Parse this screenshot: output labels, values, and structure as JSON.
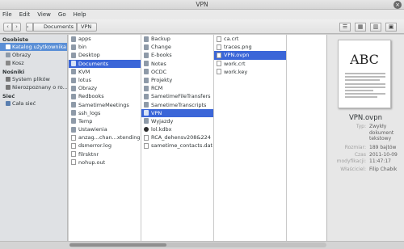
{
  "window": {
    "title": "VPN"
  },
  "menu": [
    "File",
    "Edit",
    "View",
    "Go",
    "Help"
  ],
  "toolbar": {
    "back": "‹",
    "forward": "›",
    "breadcrumb": [
      "Documents",
      "VPN"
    ],
    "views": [
      "☰",
      "▦",
      "▥",
      "▣"
    ]
  },
  "sidebar": {
    "sections": [
      {
        "title": "Osobiste",
        "items": [
          {
            "label": "Katalog użytkownika",
            "icon": "home-icon",
            "selected": true
          },
          {
            "label": "Obrazy",
            "icon": "folder-icon",
            "selected": false
          },
          {
            "label": "Kosz",
            "icon": "trash-icon",
            "selected": false
          }
        ]
      },
      {
        "title": "Nośniki",
        "items": [
          {
            "label": "System plików",
            "icon": "drive-icon",
            "selected": false
          },
          {
            "label": "Nierozpoznany o ro...",
            "icon": "drive-icon",
            "selected": false
          }
        ]
      },
      {
        "title": "Sieć",
        "items": [
          {
            "label": "Cała sieć",
            "icon": "network-icon",
            "selected": false
          }
        ]
      }
    ]
  },
  "columns": [
    {
      "items": [
        {
          "name": "apps",
          "type": "folder"
        },
        {
          "name": "bin",
          "type": "folder"
        },
        {
          "name": "Desktop",
          "type": "folder"
        },
        {
          "name": "Documents",
          "type": "folder",
          "selected": true
        },
        {
          "name": "KVM",
          "type": "folder"
        },
        {
          "name": "lotus",
          "type": "folder"
        },
        {
          "name": "Obrazy",
          "type": "folder"
        },
        {
          "name": "Redbooks",
          "type": "folder"
        },
        {
          "name": "SametimeMeetings",
          "type": "folder"
        },
        {
          "name": "ssh_logs",
          "type": "folder"
        },
        {
          "name": "Temp",
          "type": "folder"
        },
        {
          "name": "Ustawienia",
          "type": "folder"
        },
        {
          "name": "anzag...chan...xtending...fs",
          "type": "file"
        },
        {
          "name": "dsmerror.log",
          "type": "file"
        },
        {
          "name": "filrsktnr",
          "type": "file"
        },
        {
          "name": "nohup.out",
          "type": "file"
        }
      ]
    },
    {
      "items": [
        {
          "name": "Backup",
          "type": "folder"
        },
        {
          "name": "Change",
          "type": "folder"
        },
        {
          "name": "E-books",
          "type": "folder"
        },
        {
          "name": "Notes",
          "type": "folder"
        },
        {
          "name": "OCDC",
          "type": "folder"
        },
        {
          "name": "Projekty",
          "type": "folder"
        },
        {
          "name": "RCM",
          "type": "folder"
        },
        {
          "name": "SametimeFileTransfers",
          "type": "folder"
        },
        {
          "name": "SametimeTranscripts",
          "type": "folder"
        },
        {
          "name": "VPN",
          "type": "folder",
          "selected": true
        },
        {
          "name": "Wyjazdy",
          "type": "folder"
        },
        {
          "name": "lol.kdbx",
          "type": "dot"
        },
        {
          "name": "RCA_dehensv208&224",
          "type": "file"
        },
        {
          "name": "sametime_contacts.dat",
          "type": "file"
        }
      ]
    },
    {
      "items": [
        {
          "name": "ca.crt",
          "type": "file"
        },
        {
          "name": "traces.png",
          "type": "file"
        },
        {
          "name": "VPN.ovpn",
          "type": "file",
          "selected": true
        },
        {
          "name": "work.crt",
          "type": "file"
        },
        {
          "name": "work.key",
          "type": "file"
        }
      ]
    }
  ],
  "preview": {
    "thumbnail_text": "ABC",
    "filename": "VPN.ovpn",
    "details": [
      {
        "key": "Typ:",
        "value": "Zwykły dokument tekstowy"
      },
      {
        "key": "Rozmiar:",
        "value": "189 bajtów"
      },
      {
        "key": "Czas modyfikacji:",
        "value": "2011-10-09 11:47:17"
      },
      {
        "key": "Właściciel:",
        "value": "Filip Chabik"
      }
    ]
  }
}
